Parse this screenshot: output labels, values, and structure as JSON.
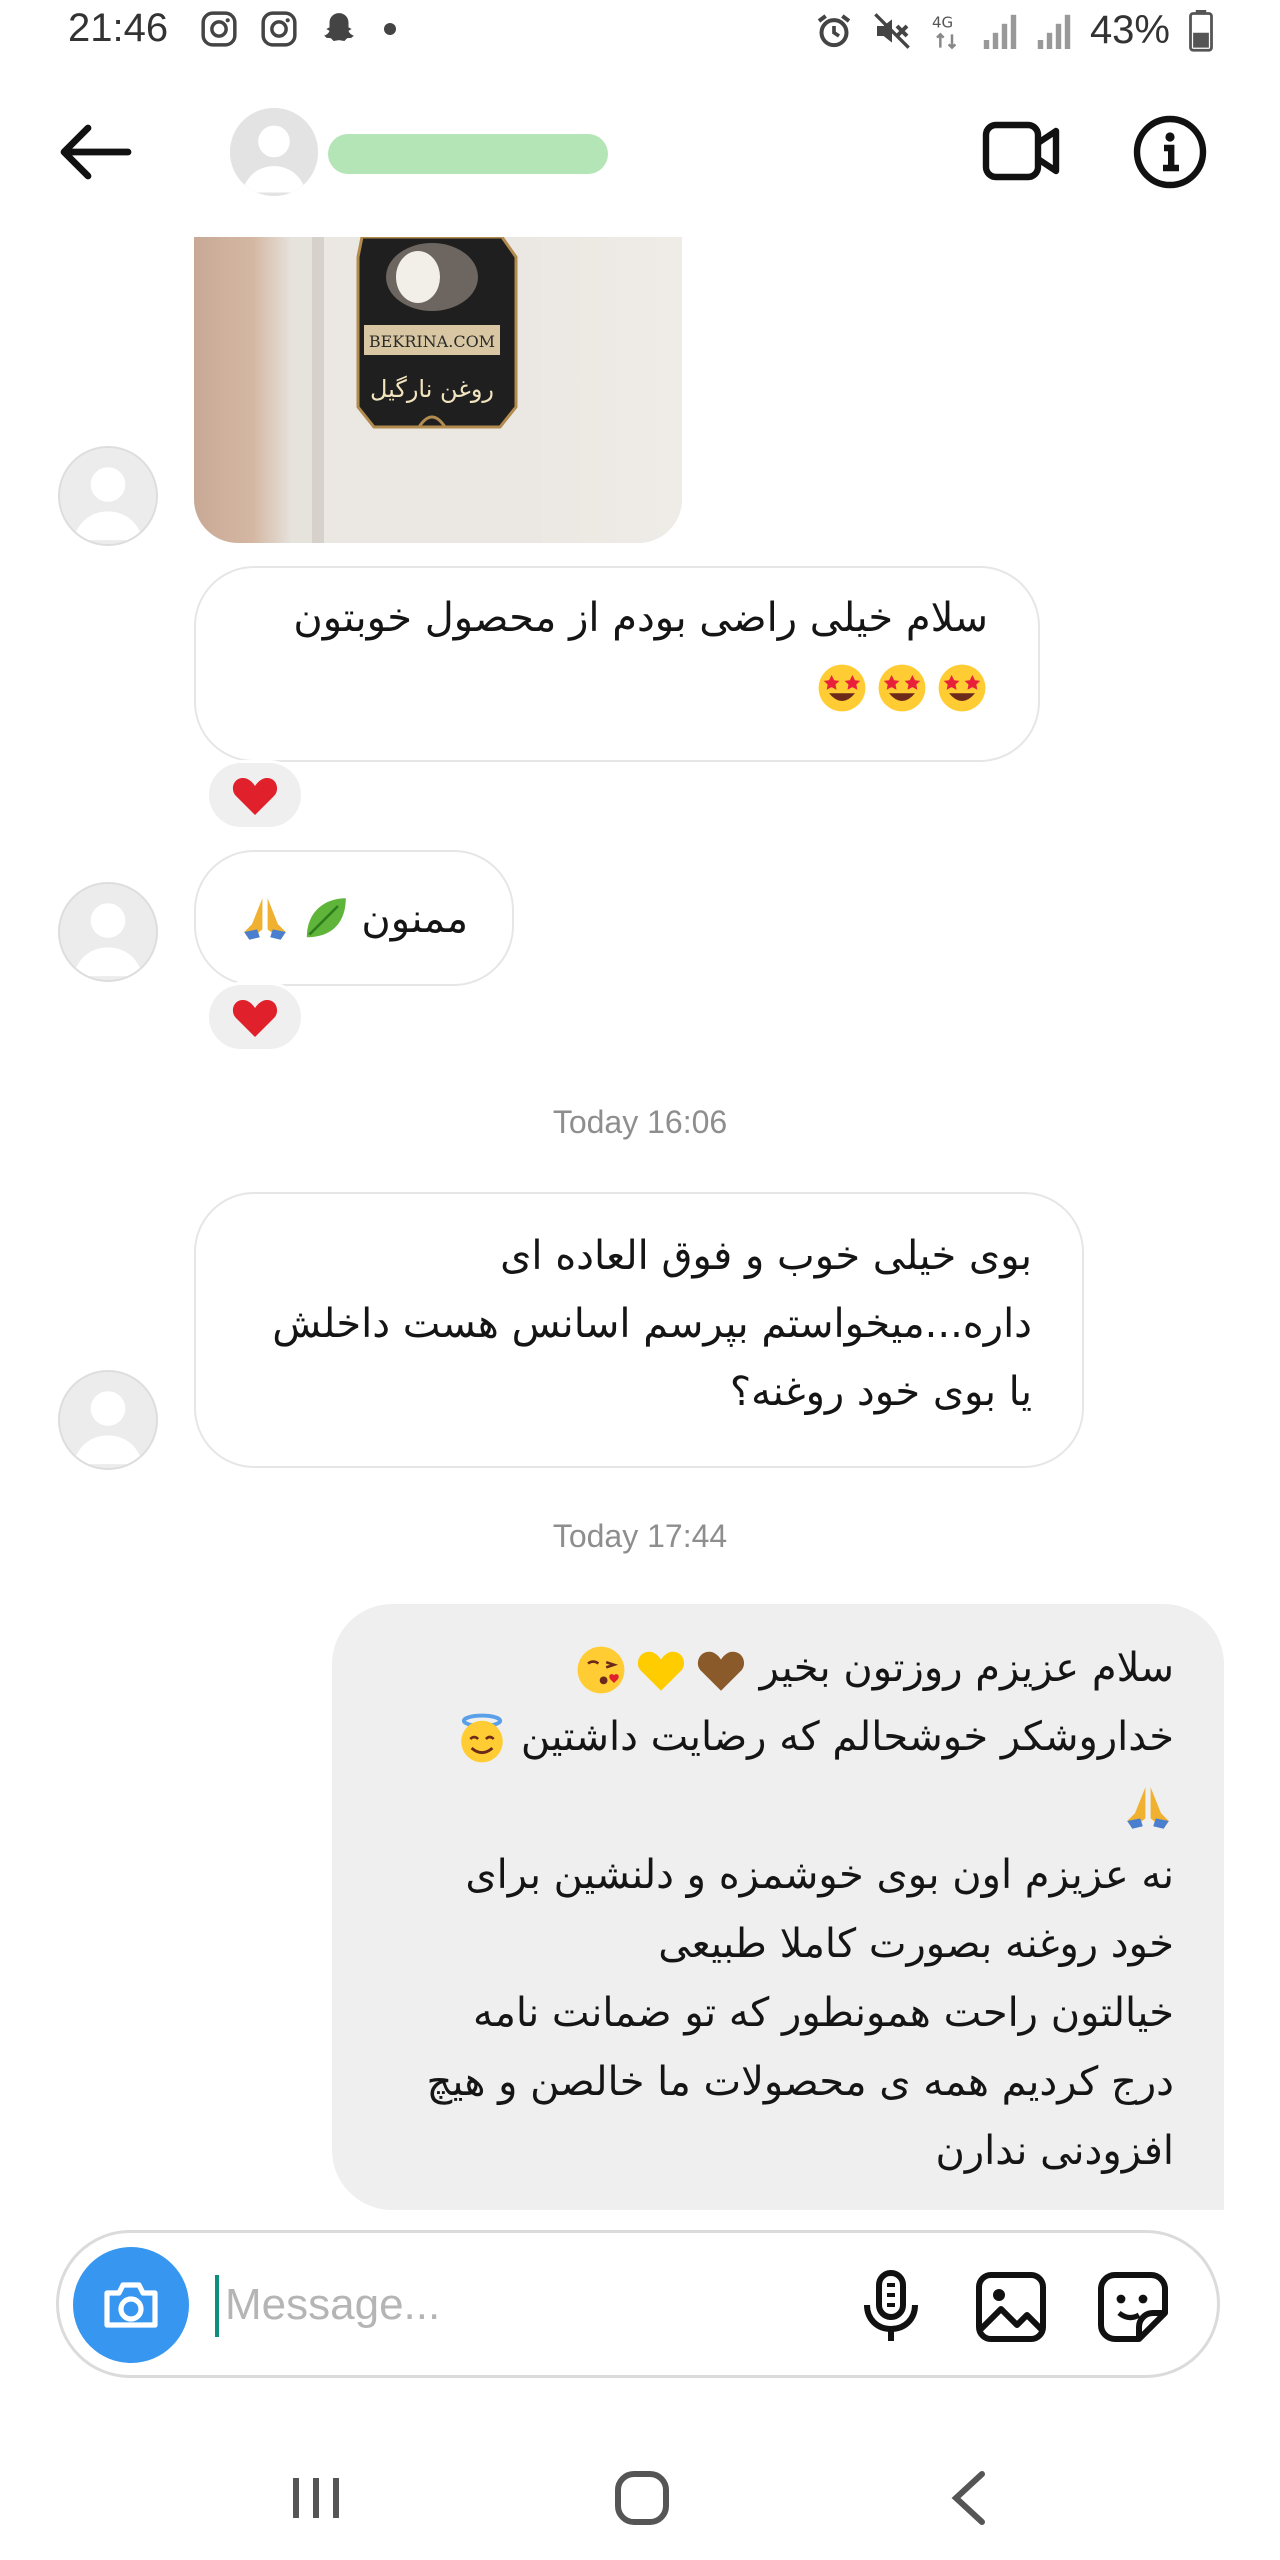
{
  "status_bar": {
    "time": "21:46",
    "battery": "43%",
    "network": "4G",
    "icons_left": [
      "instagram-icon",
      "instagram-icon",
      "snapchat-icon",
      "dot-icon"
    ],
    "icons_right": [
      "alarm-icon",
      "mute-icon",
      "network-4g-icon",
      "signal-icon",
      "signal-icon",
      "battery-icon"
    ]
  },
  "header": {
    "back_icon": "back-arrow-icon",
    "video_icon": "video-call-icon",
    "info_icon": "info-icon"
  },
  "thread": {
    "messages": [
      {
        "id": "m1",
        "direction": "incoming",
        "type": "image",
        "image_label_text": "BEKRINA.COM",
        "image_product_text": "روغن نارگیل"
      },
      {
        "id": "m2",
        "direction": "incoming",
        "text": "سلام خیلی راضی بودم از محصول خوبتون",
        "emojis": [
          "star-struck",
          "star-struck",
          "star-struck"
        ],
        "reaction": "heart"
      },
      {
        "id": "m3",
        "direction": "incoming",
        "text": "ممنون",
        "emojis": [
          "leaf",
          "folded-hands"
        ],
        "reaction": "heart"
      },
      {
        "id": "ts1",
        "type": "timestamp",
        "text": "Today 16:06"
      },
      {
        "id": "m4",
        "direction": "incoming",
        "lines": [
          "بوی خیلی خوب و فوق العاده ای",
          "داره...میخواستم بپرسم اسانس هست داخلش",
          "یا بوی خود روغنه؟"
        ]
      },
      {
        "id": "ts2",
        "type": "timestamp",
        "text": "Today 17:44"
      },
      {
        "id": "m5",
        "direction": "outgoing",
        "lines": [
          "سلام عزیزم روزتون بخیر",
          "خداروشکر خوشحالم که رضایت داشتین",
          "",
          "نه عزیزم اون بوی خوشمزه و دلنشین برای",
          "خود روغنه بصورت کاملا طبیعی",
          "خیالتون راحت همونطور که تو ضمانت نامه",
          "درج کردیم همه ی محصولات ما خالصن و هیچ",
          "افزودنی ندارن"
        ]
      }
    ]
  },
  "composer": {
    "placeholder": "Message...",
    "value": ""
  },
  "colors": {
    "accent": "#3797f0",
    "outgoing_bubble": "#efefef",
    "timestamp": "#8e8e8e",
    "heart": "#e0202b"
  }
}
